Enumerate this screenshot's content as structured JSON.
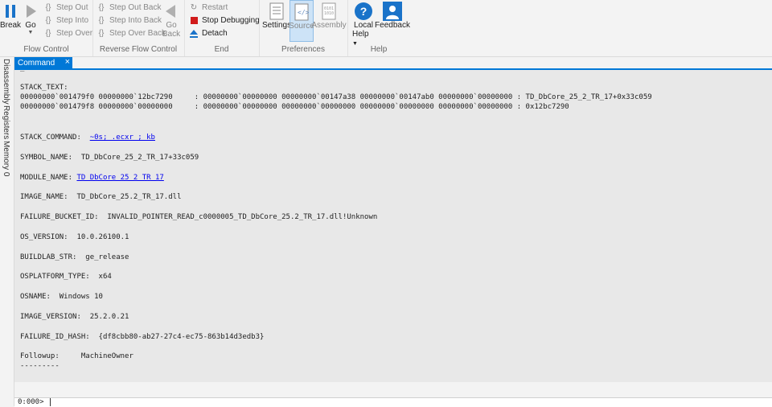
{
  "ribbon": {
    "flow_control": {
      "label": "Flow Control",
      "break": "Break",
      "go": "Go",
      "step_out": "Step Out",
      "step_into": "Step Into",
      "step_over": "Step Over"
    },
    "reverse_flow": {
      "label": "Reverse Flow Control",
      "step_out_back": "Step Out Back",
      "step_into_back": "Step Into Back",
      "step_over_back": "Step Over Back",
      "go_back_1": "Go",
      "go_back_2": "Back"
    },
    "end": {
      "label": "End",
      "restart": "Restart",
      "stop_debugging": "Stop Debugging",
      "detach": "Detach"
    },
    "preferences": {
      "label": "Preferences",
      "settings": "Settings",
      "source": "Source",
      "assembly": "Assembly"
    },
    "help": {
      "label": "Help",
      "local_help_1": "Local",
      "local_help_2": "Help",
      "feedback": "Feedback"
    }
  },
  "side_tabs": [
    "Disassembly",
    "Registers",
    "Memory 0"
  ],
  "document_tab": {
    "label": "Command",
    "close": "×"
  },
  "output": {
    "top_fragment": "_",
    "stack_text_label": "STACK_TEXT:",
    "stack_line_1": "00000000`001479f0 00000000`12bc7290     : 00000000`00000000 00000000`00147a38 00000000`00147ab0 00000000`00000000 : TD_DbCore_25_2_TR_17+0x33c059",
    "stack_line_2": "00000000`001479f8 00000000`00000000     : 00000000`00000000 00000000`00000000 00000000`00000000 00000000`00000000 : 0x12bc7290",
    "stack_command_label": "STACK_COMMAND:  ",
    "stack_command_value": "~0s; .ecxr ; kb",
    "symbol_name": "SYMBOL_NAME:  TD_DbCore_25_2_TR_17+33c059",
    "module_name_label": "MODULE_NAME: ",
    "module_name_value": "TD_DbCore_25_2_TR_17",
    "image_name": "IMAGE_NAME:  TD_DbCore_25.2_TR_17.dll",
    "failure_bucket": "FAILURE_BUCKET_ID:  INVALID_POINTER_READ_c0000005_TD_DbCore_25.2_TR_17.dll!Unknown",
    "os_version": "OS_VERSION:  10.0.26100.1",
    "buildlab": "BUILDLAB_STR:  ge_release",
    "osplatform": "OSPLATFORM_TYPE:  x64",
    "osname": "OSNAME:  Windows 10",
    "image_version": "IMAGE_VERSION:  25.2.0.21",
    "failure_id_hash": "FAILURE_ID_HASH:  {df8cbb80-ab27-27c4-ec75-863b14d3edb3}",
    "followup": "Followup:     MachineOwner",
    "dashes": "---------"
  },
  "command_line": {
    "prompt": "0:000>",
    "value": ""
  },
  "colors": {
    "accent": "#0078d7",
    "link": "#0000ee",
    "stop": "#d11b1b",
    "help_blue": "#1a73c9"
  }
}
